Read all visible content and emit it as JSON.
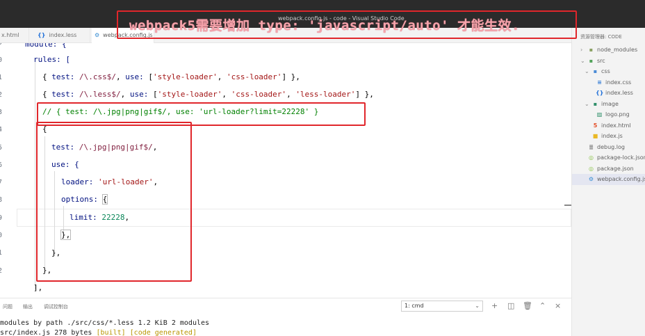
{
  "window": {
    "title": "webpack.config.js - code - Visual Studio Code"
  },
  "annotation": {
    "text": "webpack5需要增加 type: 'javascript/auto' 才能生效."
  },
  "tabs": [
    {
      "label": "x.html",
      "icon": "html-icon"
    },
    {
      "label": "index.less",
      "icon": "curly-braces-icon"
    },
    {
      "label": "webpack.config.js",
      "icon": "settings-file-icon"
    }
  ],
  "editor": {
    "line_numbers": [
      "9",
      "0",
      "1",
      "2",
      "3",
      "4",
      "5",
      "6",
      "7",
      "8",
      "9",
      "0",
      "1",
      "2"
    ],
    "lines": {
      "l0": "module: {",
      "l1_a": "rules: [",
      "l2_test": "test: ",
      "l2_regex": "/\\.css$/",
      "l2_use": "use: ",
      "l2_str1": "'style-loader'",
      "l2_str2": "'css-loader'",
      "l3_regex": "/\\.less$/",
      "l3_str3": "'less-loader'",
      "l4_comment": "// { test: /\\.jpg|png|gif$/, use: 'url-loader?limit=22228' }",
      "l5": "{",
      "l6_regex": "/\\.jpg|png|gif$/",
      "l7": "use: {",
      "l8_key": "loader: ",
      "l8_val": "'url-loader'",
      "l9_key": "options: ",
      "l10_key": "limit: ",
      "l10_val": "22228",
      "l11": "},",
      "l12": "},",
      "l13": "},",
      "l14": "],"
    }
  },
  "explorer": {
    "title": "资源管理器: CODE",
    "items": [
      {
        "label": "node_modules",
        "icon": "folder-icon"
      },
      {
        "label": "src",
        "icon": "folder-icon"
      },
      {
        "label": "css",
        "icon": "folder-icon"
      },
      {
        "label": "index.css",
        "icon": "css-file-icon"
      },
      {
        "label": "index.less",
        "icon": "curly-braces-icon"
      },
      {
        "label": "image",
        "icon": "image-folder-icon"
      },
      {
        "label": "logo.png",
        "icon": "image-file-icon"
      },
      {
        "label": "index.html",
        "icon": "html-file-icon"
      },
      {
        "label": "index.js",
        "icon": "js-file-icon"
      },
      {
        "label": "debug.log",
        "icon": "log-file-icon"
      },
      {
        "label": "package-lock.json",
        "icon": "json-file-icon"
      },
      {
        "label": "package.json",
        "icon": "json-file-icon"
      },
      {
        "label": "webpack.config.js",
        "icon": "settings-file-icon"
      }
    ]
  },
  "panel": {
    "tabs": [
      "问题",
      "输出",
      "调试控制台"
    ],
    "terminal_select": "1: cmd",
    "terminal_lines": {
      "line1": "modules by path ./src/css/*.less 1.2 KiB 2 modules",
      "line2_a": "src/index.js 278 bytes ",
      "line2_b": "[built] [code generated]"
    }
  },
  "colors": {
    "highlight_red": "#e0262b",
    "string": "#a31515",
    "comment": "#008000",
    "number": "#098658",
    "property": "#001080"
  }
}
